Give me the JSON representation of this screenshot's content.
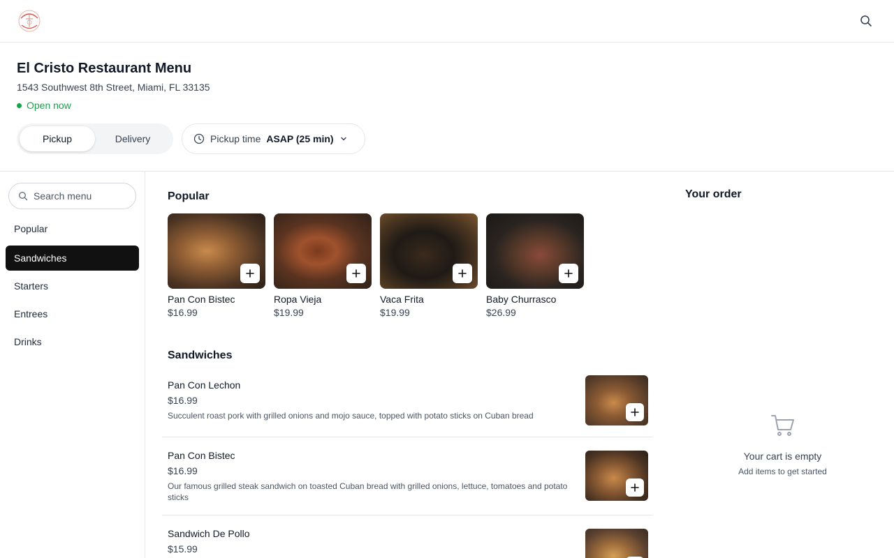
{
  "header": {
    "title": "El Cristo Restaurant Menu",
    "address": "1543 Southwest 8th Street, Miami, FL 33135",
    "status": "Open now"
  },
  "mode": {
    "pickup_label": "Pickup",
    "delivery_label": "Delivery",
    "selected": "Pickup"
  },
  "time": {
    "label": "Pickup time",
    "value": "ASAP (25 min)"
  },
  "sidebar": {
    "search_placeholder": "Search menu",
    "categories": [
      {
        "label": "Popular"
      },
      {
        "label": "Sandwiches"
      },
      {
        "label": "Starters"
      },
      {
        "label": "Entrees"
      },
      {
        "label": "Drinks"
      }
    ],
    "active": "Sandwiches"
  },
  "popular": {
    "title": "Popular",
    "items": [
      {
        "name": "Pan Con Bistec",
        "price": "$16.99"
      },
      {
        "name": "Ropa Vieja",
        "price": "$19.99"
      },
      {
        "name": "Vaca Frita",
        "price": "$19.99"
      },
      {
        "name": "Baby Churrasco",
        "price": "$26.99"
      }
    ]
  },
  "sandwiches": {
    "title": "Sandwiches",
    "items": [
      {
        "name": "Pan Con Lechon",
        "price": "$16.99",
        "description": "Succulent roast pork with grilled onions and mojo sauce, topped with potato sticks on Cuban bread"
      },
      {
        "name": "Pan Con Bistec",
        "price": "$16.99",
        "description": "Our famous grilled steak sandwich on toasted Cuban bread with grilled onions, lettuce, tomatoes and potato sticks"
      },
      {
        "name": "Sandwich De Pollo",
        "price": "$15.99",
        "description": ""
      }
    ]
  },
  "order": {
    "title": "Your order",
    "empty_title": "Your cart is empty",
    "empty_subtitle": "Add items to get started"
  },
  "colors": {
    "accent": "#111111",
    "open_status": "#16a34a",
    "border": "#e5e7eb"
  },
  "icons": [
    "logo",
    "search-icon",
    "clock-icon",
    "chevron-down-icon",
    "plus-icon",
    "cart-icon"
  ]
}
